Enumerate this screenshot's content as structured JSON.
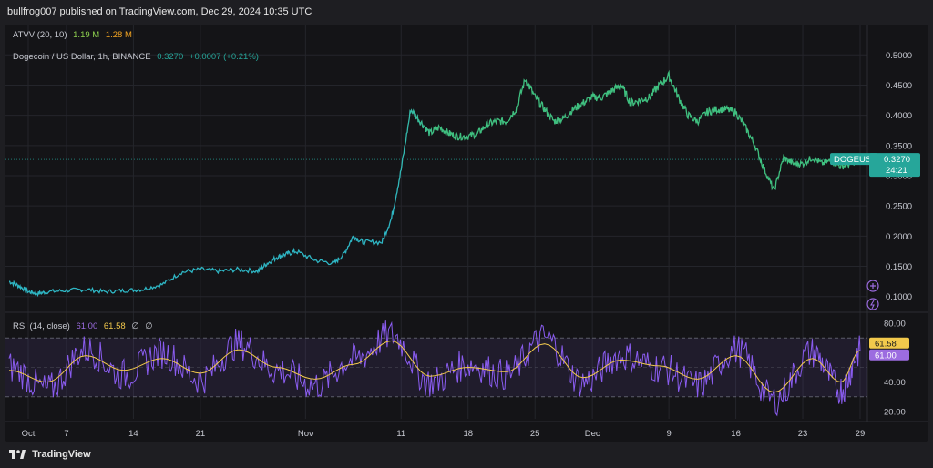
{
  "header": {
    "published": "bullfrog007 published on TradingView.com, Dec 29, 2024 10:35 UTC"
  },
  "volume_legend": {
    "label": "ATVV (20, 10)",
    "value1": "1.19 M",
    "value1_color": "#8fd14f",
    "value2": "1.28 M",
    "value2_color": "#f5a623"
  },
  "price_legend": {
    "symbol": "Dogecoin / US Dollar, 1h, BINANCE",
    "last": "0.3270",
    "change": "+0.0007 (+0.21%)",
    "color": "#26a69a"
  },
  "price_tag": {
    "symbol": "DOGEUSD",
    "value": "0.3270",
    "countdown": "24:21",
    "color": "#26a69a"
  },
  "rsi_legend": {
    "label": "RSI (14, close)",
    "rsi": "61.00",
    "rsi_color": "#9c6ce0",
    "ma": "61.58",
    "ma_color": "#f2c94c",
    "icons": [
      "∅",
      "∅"
    ]
  },
  "rsi_tags": {
    "ma": "61.58",
    "rsi": "61.00"
  },
  "footer": {
    "brand": "TradingView"
  },
  "colors": {
    "background": "#141417",
    "line_low": "#2eb6c4",
    "line_high": "#3fbf7f",
    "rsi": "#8a5cf0",
    "rsi_ma": "#f2c94c"
  },
  "chart_data": [
    {
      "type": "line",
      "title": "Dogecoin / US Dollar, 1h, BINANCE",
      "x_tick_labels": [
        "Oct",
        "7",
        "14",
        "21",
        "Nov",
        "11",
        "18",
        "25",
        "Dec",
        "9",
        "16",
        "23",
        "29"
      ],
      "y_tick_labels": [
        "0.5000",
        "0.4500",
        "0.4000",
        "0.3500",
        "0.3000",
        "0.2500",
        "0.2000",
        "0.1500",
        "0.1000"
      ],
      "ylim": [
        0.08,
        0.52
      ],
      "x_range": [
        "Oct 1",
        "Dec 29"
      ],
      "grid": true,
      "series": [
        {
          "x": [
            "Oct 1",
            "Oct 2",
            "Oct 3",
            "Oct 4",
            "Oct 5",
            "Oct 7",
            "Oct 9",
            "Oct 11",
            "Oct 13",
            "Oct 15",
            "Oct 17",
            "Oct 19",
            "Oct 21",
            "Oct 23",
            "Oct 25",
            "Oct 27",
            "Oct 28",
            "Oct 29",
            "Oct 30",
            "Oct 31",
            "Nov 2",
            "Nov 4",
            "Nov 5",
            "Nov 6",
            "Nov 7",
            "Nov 9",
            "Nov 10",
            "Nov 11",
            "Nov 12",
            "Nov 13",
            "Nov 14",
            "Nov 15",
            "Nov 16",
            "Nov 17",
            "Nov 18",
            "Nov 19",
            "Nov 20",
            "Nov 21",
            "Nov 22",
            "Nov 23",
            "Nov 24",
            "Nov 25",
            "Nov 26",
            "Nov 27",
            "Nov 28",
            "Nov 29",
            "Nov 30",
            "Dec 1",
            "Dec 2",
            "Dec 3",
            "Dec 4",
            "Dec 5",
            "Dec 6",
            "Dec 7",
            "Dec 8",
            "Dec 9",
            "Dec 10",
            "Dec 11",
            "Dec 12",
            "Dec 13",
            "Dec 14",
            "Dec 15",
            "Dec 16",
            "Dec 17",
            "Dec 18",
            "Dec 19",
            "Dec 20",
            "Dec 21",
            "Dec 22",
            "Dec 23",
            "Dec 24",
            "Dec 25",
            "Dec 26",
            "Dec 27",
            "Dec 28",
            "Dec 29"
          ],
          "y": [
            0.125,
            0.118,
            0.108,
            0.105,
            0.108,
            0.11,
            0.112,
            0.108,
            0.11,
            0.112,
            0.12,
            0.14,
            0.145,
            0.142,
            0.145,
            0.142,
            0.155,
            0.165,
            0.17,
            0.175,
            0.16,
            0.155,
            0.17,
            0.2,
            0.19,
            0.19,
            0.23,
            0.31,
            0.41,
            0.39,
            0.37,
            0.38,
            0.37,
            0.365,
            0.365,
            0.37,
            0.385,
            0.39,
            0.39,
            0.41,
            0.46,
            0.43,
            0.41,
            0.39,
            0.395,
            0.41,
            0.42,
            0.43,
            0.43,
            0.44,
            0.45,
            0.42,
            0.425,
            0.43,
            0.45,
            0.465,
            0.43,
            0.4,
            0.39,
            0.405,
            0.41,
            0.41,
            0.405,
            0.38,
            0.35,
            0.31,
            0.275,
            0.33,
            0.32,
            0.32,
            0.33,
            0.32,
            0.325,
            0.315,
            0.32,
            0.327
          ]
        }
      ]
    },
    {
      "type": "line",
      "title": "RSI (14, close)",
      "y_tick_labels": [
        "80.00",
        "60.00",
        "40.00",
        "20.00"
      ],
      "ylim": [
        15,
        85
      ],
      "bands": [
        70,
        30
      ],
      "series": [
        {
          "name": "RSI",
          "x": [
            "Oct 1",
            "Oct 5",
            "Oct 9",
            "Oct 13",
            "Oct 17",
            "Oct 21",
            "Oct 25",
            "Oct 29",
            "Nov 2",
            "Nov 6",
            "Nov 10",
            "Nov 14",
            "Nov 18",
            "Nov 22",
            "Nov 26",
            "Nov 30",
            "Dec 4",
            "Dec 8",
            "Dec 12",
            "Dec 16",
            "Dec 20",
            "Dec 24",
            "Dec 27",
            "Dec 29"
          ],
          "y": [
            50,
            35,
            62,
            45,
            60,
            42,
            66,
            48,
            38,
            55,
            72,
            40,
            52,
            45,
            70,
            40,
            58,
            50,
            38,
            62,
            28,
            60,
            35,
            61
          ]
        },
        {
          "name": "MA",
          "x": [
            "Oct 1",
            "Oct 5",
            "Oct 9",
            "Oct 13",
            "Oct 17",
            "Oct 21",
            "Oct 25",
            "Oct 29",
            "Nov 2",
            "Nov 6",
            "Nov 10",
            "Nov 14",
            "Nov 18",
            "Nov 22",
            "Nov 26",
            "Nov 30",
            "Dec 4",
            "Dec 8",
            "Dec 12",
            "Dec 16",
            "Dec 20",
            "Dec 24",
            "Dec 27",
            "Dec 29"
          ],
          "y": [
            48,
            40,
            58,
            48,
            56,
            46,
            62,
            50,
            42,
            52,
            68,
            44,
            50,
            47,
            66,
            43,
            55,
            51,
            42,
            58,
            33,
            56,
            40,
            61.58
          ]
        }
      ]
    }
  ]
}
